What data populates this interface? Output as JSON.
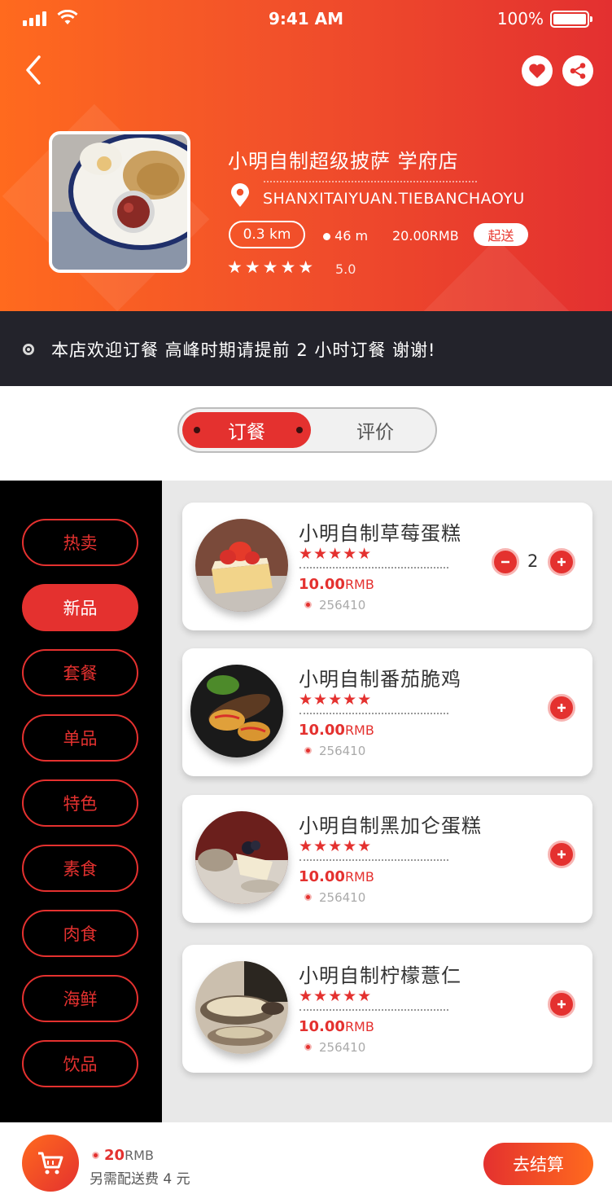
{
  "status_bar": {
    "time": "9:41 AM",
    "battery": "100%"
  },
  "shop": {
    "name": "小明自制超级披萨  学府店",
    "address": "SHANXITAIYUAN.TIEBANCHAOYU",
    "distance": "0.3 km",
    "meters": "46 m",
    "delivery_fee": "20.00RMB",
    "send_badge": "起送",
    "stars": "★★★★★",
    "rating": "5.0"
  },
  "notice": {
    "text": "本店欢迎订餐  高峰时期请提前 2 小时订餐  谢谢!"
  },
  "tabs": {
    "order": "订餐",
    "review": "评价"
  },
  "categories": [
    {
      "label": "热卖",
      "active": false
    },
    {
      "label": "新品",
      "active": true
    },
    {
      "label": "套餐",
      "active": false
    },
    {
      "label": "单品",
      "active": false
    },
    {
      "label": "特色",
      "active": false
    },
    {
      "label": "素食",
      "active": false
    },
    {
      "label": "肉食",
      "active": false
    },
    {
      "label": "海鲜",
      "active": false
    },
    {
      "label": "饮品",
      "active": false
    }
  ],
  "products": [
    {
      "name": "小明自制草莓蛋糕",
      "stars": "★★★★★",
      "price": "10.00",
      "unit": "RMB",
      "code": "256410",
      "quantity": "2"
    },
    {
      "name": "小明自制番茄脆鸡",
      "stars": "★★★★★",
      "price": "10.00",
      "unit": "RMB",
      "code": "256410"
    },
    {
      "name": "小明自制黑加仑蛋糕",
      "stars": "★★★★★",
      "price": "10.00",
      "unit": "RMB",
      "code": "256410"
    },
    {
      "name": "小明自制柠檬薏仁",
      "stars": "★★★★★",
      "price": "10.00",
      "unit": "RMB",
      "code": "256410"
    }
  ],
  "cart": {
    "total": "20",
    "unit": "RMB",
    "note": "另需配送费 4 元",
    "checkout_label": "去结算"
  },
  "colors": {
    "accent": "#e4312f",
    "orange": "#ff6a1e",
    "dark": "#23232b"
  }
}
